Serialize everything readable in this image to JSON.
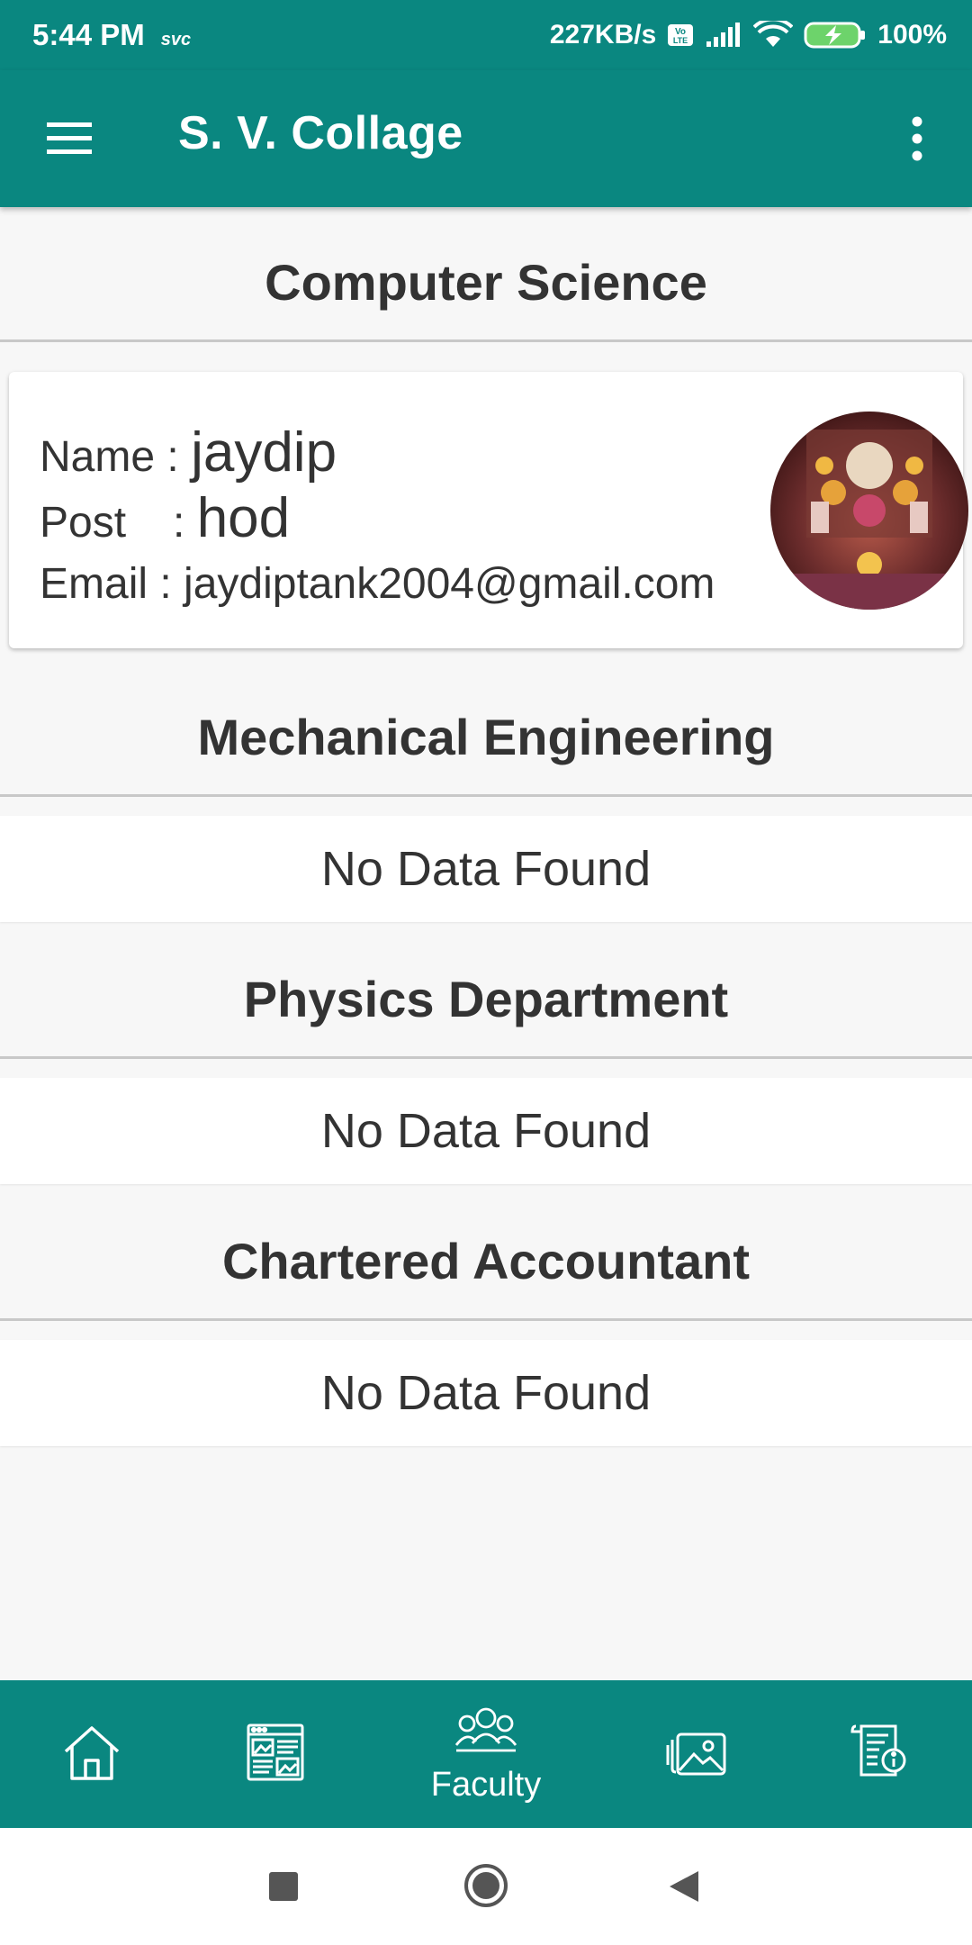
{
  "status_bar": {
    "time": "5:44 PM",
    "carrier": "svc",
    "speed": "227KB/s",
    "battery": "100%"
  },
  "app_bar": {
    "title": "S. V. Collage"
  },
  "sections": [
    {
      "title": "Computer Science",
      "faculty": {
        "name_label": "Name :",
        "name": "jaydip",
        "post_label": "Post",
        "post_sep": ":",
        "post": "hod",
        "email_label": "Email :",
        "email": "jaydiptank2004@gmail.com"
      }
    },
    {
      "title": "Mechanical Engineering",
      "empty_text": "No Data Found"
    },
    {
      "title": "Physics Department",
      "empty_text": "No Data Found"
    },
    {
      "title": "Chartered Accountant",
      "empty_text": "No Data Found"
    }
  ],
  "bottom_nav": {
    "items": [
      {
        "icon": "home-icon"
      },
      {
        "icon": "news-icon"
      },
      {
        "icon": "faculty-icon",
        "label": "Faculty",
        "active": true
      },
      {
        "icon": "gallery-icon"
      },
      {
        "icon": "info-document-icon"
      }
    ]
  },
  "colors": {
    "primary": "#0a8780",
    "background": "#f7f7f7",
    "text": "#333333"
  }
}
